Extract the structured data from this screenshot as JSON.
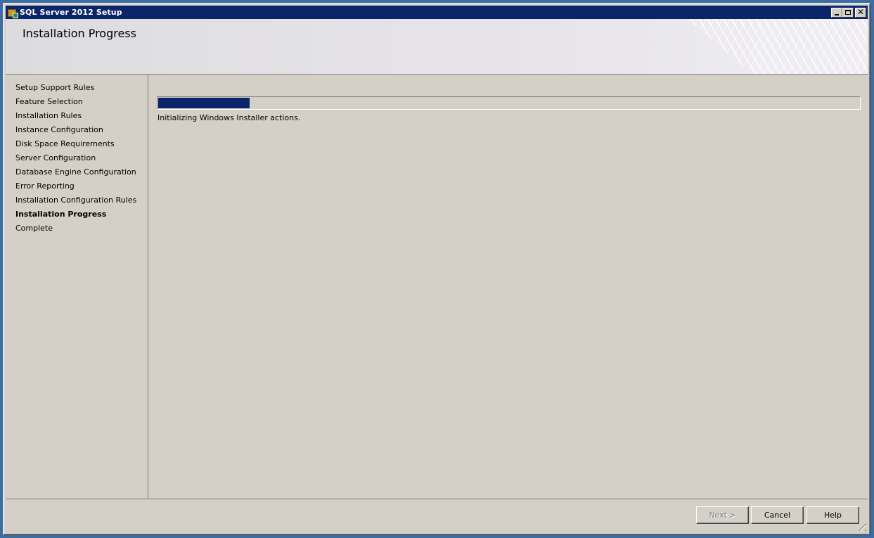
{
  "window": {
    "title": "SQL Server 2012 Setup",
    "icon": "setup-package-icon",
    "controls": [
      "minimize-icon",
      "maximize-icon",
      "close-icon"
    ],
    "close_glyph": "✕"
  },
  "header": {
    "title": "Installation Progress"
  },
  "sidebar": {
    "items": [
      {
        "label": "Setup Support Rules",
        "active": false
      },
      {
        "label": "Feature Selection",
        "active": false
      },
      {
        "label": "Installation Rules",
        "active": false
      },
      {
        "label": "Instance Configuration",
        "active": false
      },
      {
        "label": "Disk Space Requirements",
        "active": false
      },
      {
        "label": "Server Configuration",
        "active": false
      },
      {
        "label": "Database Engine Configuration",
        "active": false
      },
      {
        "label": "Error Reporting",
        "active": false
      },
      {
        "label": "Installation Configuration Rules",
        "active": false
      },
      {
        "label": "Installation Progress",
        "active": true
      },
      {
        "label": "Complete",
        "active": false
      }
    ]
  },
  "main": {
    "progress_percent": 13,
    "progress_color": "#0a246a",
    "status_text": "Initializing Windows Installer actions."
  },
  "footer": {
    "next_label": "Next >",
    "next_enabled": false,
    "cancel_label": "Cancel",
    "help_label": "Help"
  }
}
